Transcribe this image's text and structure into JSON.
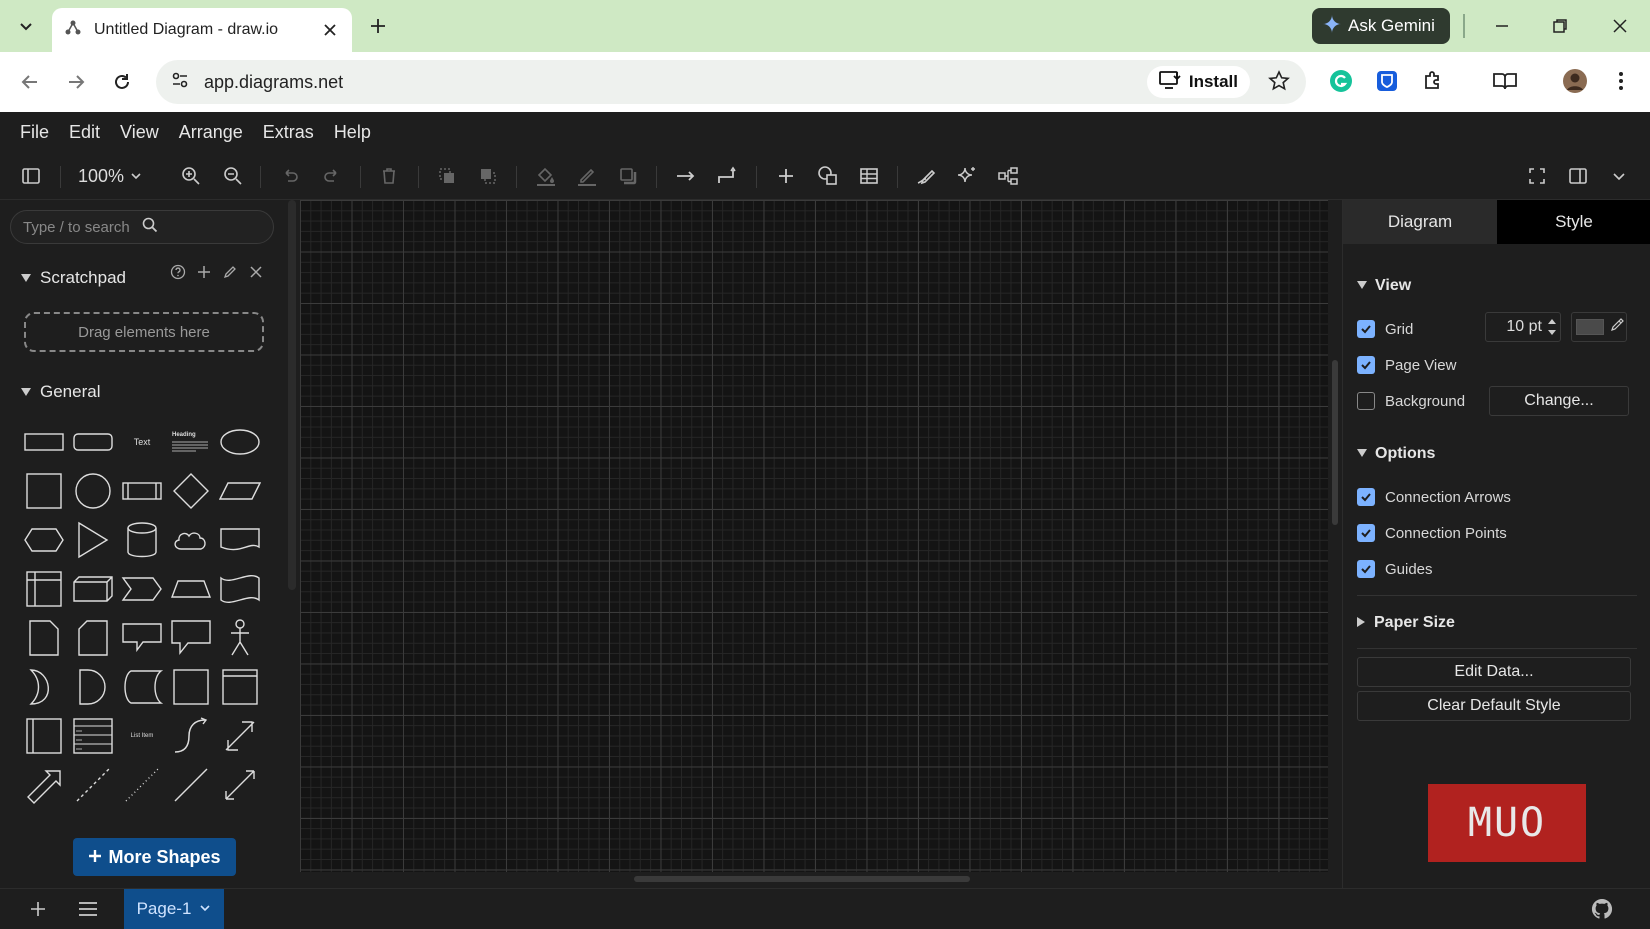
{
  "browser": {
    "tab_title": "Untitled Diagram - draw.io",
    "ask_gemini": "Ask Gemini",
    "url": "app.diagrams.net",
    "install": "Install"
  },
  "menu": [
    "File",
    "Edit",
    "View",
    "Arrange",
    "Extras",
    "Help"
  ],
  "toolbar": {
    "zoom": "100%"
  },
  "left": {
    "search_placeholder": "Type / to search",
    "scratchpad": "Scratchpad",
    "dropzone": "Drag elements here",
    "general": "General",
    "shape_text": "Text",
    "shape_heading": "Heading",
    "shape_list_item": "List Item",
    "more_shapes": "More Shapes"
  },
  "right": {
    "tab_diagram": "Diagram",
    "tab_style": "Style",
    "view": "View",
    "grid": "Grid",
    "grid_size": "10 pt",
    "page_view": "Page View",
    "background": "Background",
    "change": "Change...",
    "options": "Options",
    "connection_arrows": "Connection Arrows",
    "connection_points": "Connection Points",
    "guides": "Guides",
    "paper_size": "Paper Size",
    "edit_data": "Edit Data...",
    "clear_default_style": "Clear Default Style",
    "watermark": "MUO"
  },
  "bottom": {
    "page": "Page-1"
  }
}
